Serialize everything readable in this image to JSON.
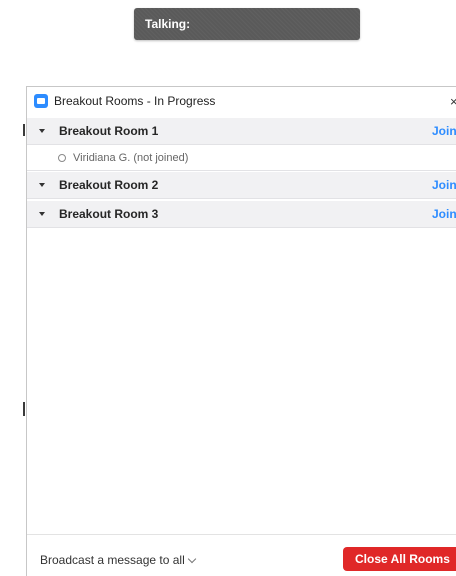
{
  "talking_bar": {
    "label": "Talking:"
  },
  "window": {
    "title": "Breakout Rooms - In Progress",
    "close_glyph": "×"
  },
  "rooms": [
    {
      "name": "Breakout Room 1",
      "join_label": "Join",
      "participants": [
        {
          "name": "Viridiana G. (not joined)"
        }
      ]
    },
    {
      "name": "Breakout Room 2",
      "join_label": "Join",
      "participants": []
    },
    {
      "name": "Breakout Room 3",
      "join_label": "Join",
      "participants": []
    }
  ],
  "footer": {
    "broadcast_label": "Broadcast a message to all",
    "close_all_label": "Close All Rooms"
  },
  "colors": {
    "accent": "#2d8cff",
    "danger": "#e02828"
  },
  "icons": {
    "app": "breakout-app-icon",
    "close": "close-icon",
    "expand": "caret-down-icon",
    "status": "status-circle-icon"
  }
}
